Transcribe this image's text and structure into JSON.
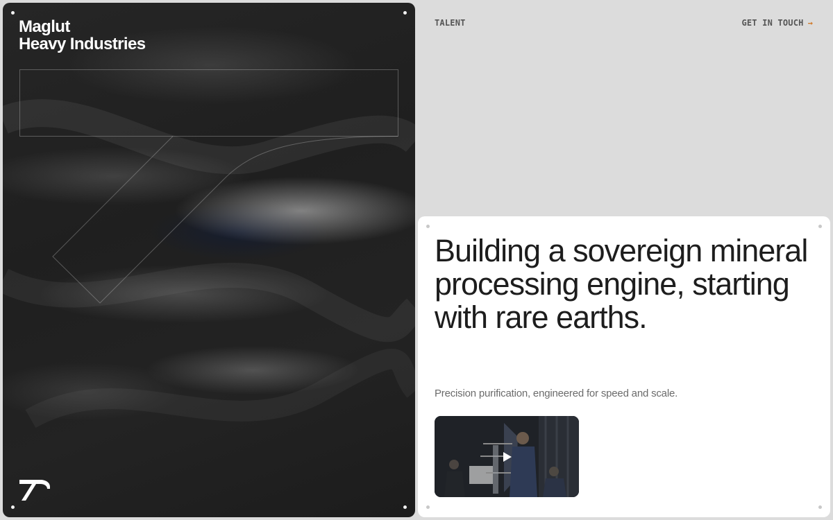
{
  "brand": {
    "line1": "Maglut",
    "line2": "Heavy Industries"
  },
  "nav": {
    "talent": "TALENT",
    "contact": "GET IN TOUCH",
    "contact_arrow": "→"
  },
  "hero": {
    "headline": "Building a sovereign mineral processing engine, starting with rare earths.",
    "subtext": "Precision purification, engineered for speed and scale."
  },
  "colors": {
    "page_bg": "#dcdcdc",
    "hero_bg": "#1f1f1f",
    "card_bg": "#ffffff",
    "headline": "#1d1d1d",
    "arrow_accent": "#d07a2a"
  },
  "icons": {
    "logo": "brand-logo-mark-icon",
    "play": "play-icon"
  }
}
